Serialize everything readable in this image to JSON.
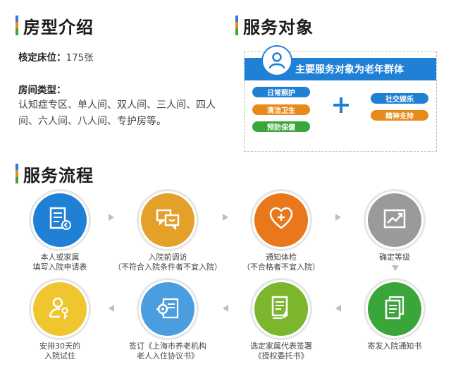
{
  "room_section": {
    "title": "房型介绍",
    "beds_label": "核定床位：",
    "beds_value": "175张",
    "types_label": "房间类型：",
    "types_text": "认知症专区、单人间、双人间、三人间、四人间、六人间、八人间、专护房等。"
  },
  "service_section": {
    "title": "服务对象",
    "banner": "主要服务对象为老年群体",
    "left_pills": [
      {
        "label": "日常照护",
        "color": "#1f80d6"
      },
      {
        "label": "清洁卫生",
        "color": "#e8891b"
      },
      {
        "label": "预防保健",
        "color": "#3aa63a"
      }
    ],
    "right_pills": [
      {
        "label": "社交娱乐",
        "color": "#1f80d6"
      },
      {
        "label": "精神支持",
        "color": "#e8891b"
      }
    ]
  },
  "process_section": {
    "title": "服务流程",
    "steps": [
      {
        "label": "本人或家属\n填写入院申请表",
        "color": "#1f80d6",
        "icon": "application-form-icon"
      },
      {
        "label": "入院前调访\n（不符合入院条件者不宜入院）",
        "color": "#e3a12a",
        "icon": "chat-bubbles-icon"
      },
      {
        "label": "通知体检\n（不合格者不宜入院）",
        "color": "#e8781b",
        "icon": "heart-plus-icon"
      },
      {
        "label": "确定等级",
        "color": "#9a9a9a",
        "icon": "trend-chart-icon"
      },
      {
        "label": "寄发入院通知书",
        "color": "#3aa63a",
        "icon": "documents-icon"
      },
      {
        "label": "选定家属代表签署\n《授权委托书》",
        "color": "#7bb62c",
        "icon": "sign-document-icon"
      },
      {
        "label": "签订《上海市养老机构\n老人入住协议书》",
        "color": "#4a9ee0",
        "icon": "gear-document-icon"
      },
      {
        "label": "安排30天的\n入院试住",
        "color": "#f0c630",
        "icon": "person-key-icon"
      }
    ]
  }
}
